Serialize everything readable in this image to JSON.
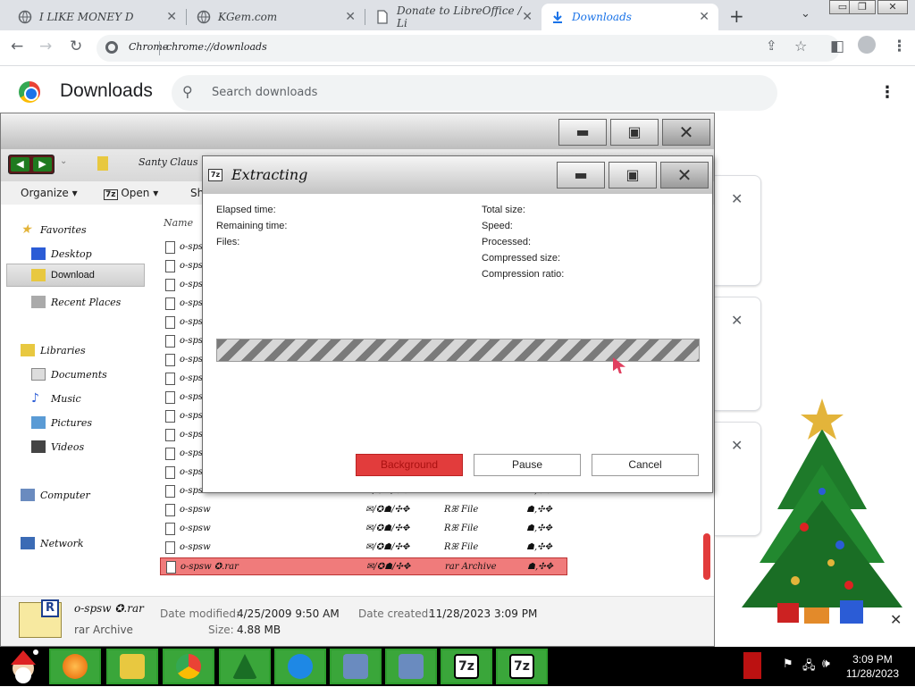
{
  "browser": {
    "tabs": [
      {
        "title": "I LIKE MONEY D",
        "active": false
      },
      {
        "title": "KGem.com",
        "active": false
      },
      {
        "title": "Donate to LibreOffice / Li",
        "active": false
      },
      {
        "title": "Downloads",
        "active": true
      }
    ],
    "new_tab_label": "+",
    "omnibox": {
      "site": "Chrome",
      "url": "chrome://downloads"
    }
  },
  "downloads_page": {
    "title": "Downloads",
    "search_placeholder": "Search downloads",
    "card_close": "✕"
  },
  "explorer": {
    "breadcrumb": "Santy Claus",
    "toolbar": {
      "organize": "Organize",
      "open": "Open",
      "share": "Sh"
    },
    "column_name": "Name",
    "nav": {
      "favorites": "Favorites",
      "desktop": "Desktop",
      "download": "Download",
      "recent": "Recent Places",
      "libraries": "Libraries",
      "documents": "Documents",
      "music": "Music",
      "pictures": "Pictures",
      "videos": "Videos",
      "computer": "Computer",
      "network": "Network"
    },
    "files": [
      {
        "name": "o-spsw"
      },
      {
        "name": "o-spsw"
      },
      {
        "name": "o-spsw"
      },
      {
        "name": "o-spsw"
      },
      {
        "name": "o-spsw"
      },
      {
        "name": "o-spsw"
      },
      {
        "name": "o-spsw"
      },
      {
        "name": "o-spsw"
      },
      {
        "name": "o-spsw"
      },
      {
        "name": "o-spsw"
      },
      {
        "name": "o-spsw"
      },
      {
        "name": "o-spsw"
      },
      {
        "name": "o-spsw",
        "date": "✉/✪☗/✣✥",
        "type": "Rꕤ File",
        "size": "☗,✣✥"
      },
      {
        "name": "o-spsw",
        "date": "✉/✪☗/✣✥",
        "type": "Rꕤ File",
        "size": "☗,✣✥"
      },
      {
        "name": "o-spsw",
        "date": "✉/✪☗/✣✥",
        "type": "Rꕤ File",
        "size": "☗,✣✥"
      },
      {
        "name": "o-spsw",
        "date": "✉/✪☗/✣✥",
        "type": "Rꕤ File",
        "size": "☗,✣✥"
      },
      {
        "name": "o-spsw",
        "date": "✉/✪☗/✣✥",
        "type": "Rꕤ File",
        "size": "☗,✣✥"
      },
      {
        "name": "o-spsw ✪.rar",
        "date": "✉/✪☗/✣✥",
        "type": "rar Archive",
        "size": "☗,✣✥"
      }
    ],
    "details": {
      "name": "o-spsw ✪.rar",
      "type": "rar Archive",
      "modified_label": "Date modified:",
      "modified": "4/25/2009 9:50 AM",
      "created_label": "Date created:",
      "created": "11/28/2023 3:09 PM",
      "size_label": "Size:",
      "size": "4.88 MB"
    }
  },
  "dialog": {
    "title": "Extracting",
    "left_stats": [
      "Elapsed time:",
      "Remaining time:",
      "Files:"
    ],
    "right_stats": [
      "Total size:",
      "Speed:",
      "Processed:",
      "Compressed size:",
      "Compression ratio:"
    ],
    "buttons": {
      "background": "Background",
      "pause": "Pause",
      "cancel": "Cancel"
    }
  },
  "taskbar": {
    "time": "3:09 PM",
    "date": "11/28/2023"
  },
  "colors": {
    "chrome_blue": "#1a73e8",
    "taskbar_green": "#3aa63a",
    "selection_red": "#f07b7b",
    "background_button": "#e23c3c"
  }
}
